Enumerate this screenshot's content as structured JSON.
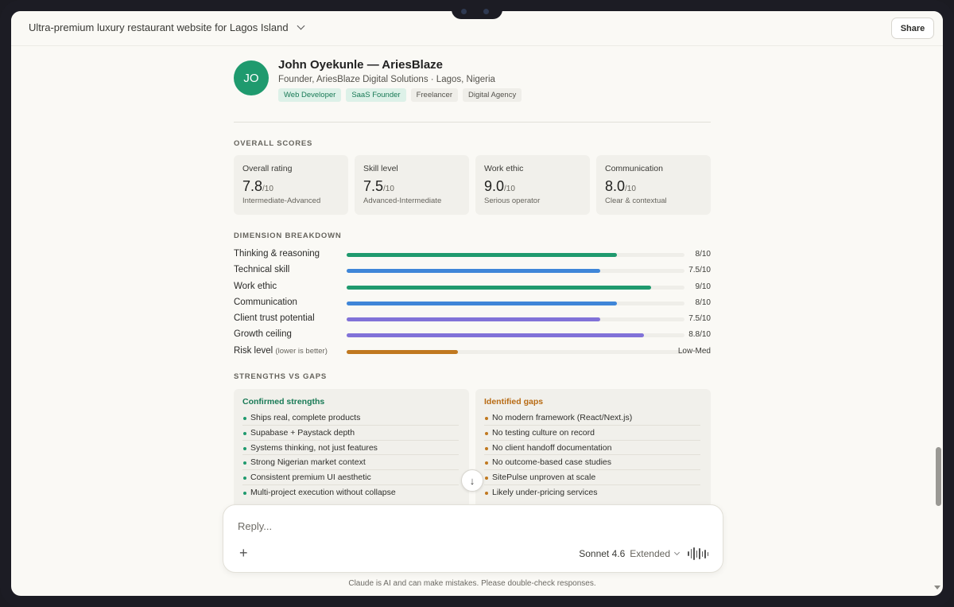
{
  "header": {
    "conversation_title": "Ultra-premium luxury restaurant website for Lagos Island",
    "share_label": "Share"
  },
  "profile": {
    "initials": "JO",
    "name": "John Oyekunle — AriesBlaze",
    "subtitle": "Founder, AriesBlaze Digital Solutions · Lagos, Nigeria",
    "tags": [
      {
        "label": "Web Developer"
      },
      {
        "label": "SaaS Founder"
      },
      {
        "label": "Freelancer"
      },
      {
        "label": "Digital Agency"
      }
    ]
  },
  "scores": {
    "section_label": "OVERALL SCORES",
    "cards": [
      {
        "label": "Overall rating",
        "value": "7.8",
        "unit": "/10",
        "sub": "Intermediate-Advanced"
      },
      {
        "label": "Skill level",
        "value": "7.5",
        "unit": "/10",
        "sub": "Advanced-Intermediate"
      },
      {
        "label": "Work ethic",
        "value": "9.0",
        "unit": "/10",
        "sub": "Serious operator"
      },
      {
        "label": "Communication",
        "value": "8.0",
        "unit": "/10",
        "sub": "Clear & contextual"
      }
    ]
  },
  "dimensions": {
    "section_label": "DIMENSION BREAKDOWN",
    "rows": [
      {
        "label": "Thinking & reasoning",
        "note": "",
        "value_text": "8/10",
        "fraction": 0.8,
        "color": "#1f9a6e"
      },
      {
        "label": "Technical skill",
        "note": "",
        "value_text": "7.5/10",
        "fraction": 0.75,
        "color": "#3f86d8"
      },
      {
        "label": "Work ethic",
        "note": "",
        "value_text": "9/10",
        "fraction": 0.9,
        "color": "#1f9a6e"
      },
      {
        "label": "Communication",
        "note": "",
        "value_text": "8/10",
        "fraction": 0.8,
        "color": "#3f86d8"
      },
      {
        "label": "Client trust potential",
        "note": "",
        "value_text": "7.5/10",
        "fraction": 0.75,
        "color": "#8172d8"
      },
      {
        "label": "Growth ceiling",
        "note": "",
        "value_text": "8.8/10",
        "fraction": 0.88,
        "color": "#8172d8"
      },
      {
        "label": "Risk level",
        "note": "(lower is better)",
        "value_text": "Low-Med",
        "fraction": 0.33,
        "color": "#c0781f"
      }
    ]
  },
  "strengths_gaps": {
    "section_label": "STRENGTHS VS GAPS",
    "strengths": {
      "title": "Confirmed strengths",
      "color": "#1f9a6e",
      "items": [
        "Ships real, complete products",
        "Supabase + Paystack depth",
        "Systems thinking, not just features",
        "Strong Nigerian market context",
        "Consistent premium UI aesthetic",
        "Multi-project execution without collapse"
      ]
    },
    "gaps": {
      "title": "Identified gaps",
      "color": "#c0781f",
      "items": [
        "No modern framework (React/Next.js)",
        "No testing culture on record",
        "No client handoff documentation",
        "No outcome-based case studies",
        "SitePulse unproven at scale",
        "Likely under-pricing services"
      ]
    }
  },
  "composer": {
    "placeholder": "Reply...",
    "model": "Sonnet 4.6",
    "mode": "Extended"
  },
  "footer": {
    "disclaimer": "Claude is AI and can make mistakes. Please double-check responses."
  }
}
